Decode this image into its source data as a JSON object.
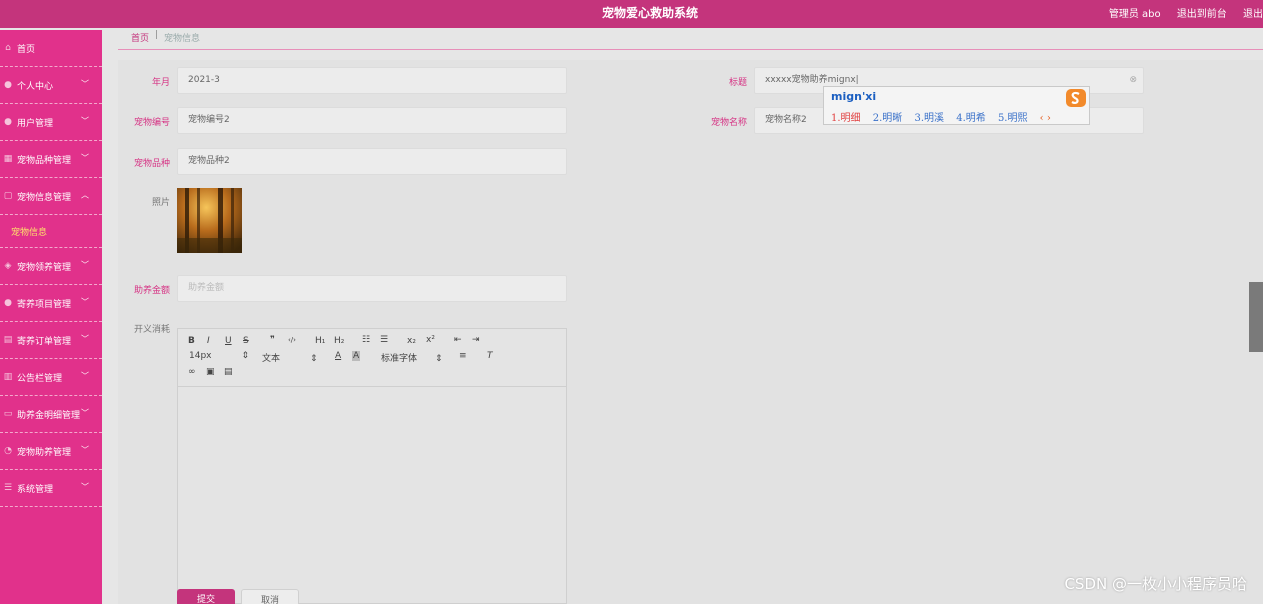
{
  "header": {
    "app_title": "宠物爱心救助系统",
    "admin_label": "管理员 abo",
    "front_link": "退出到前台",
    "logout_link": "退出"
  },
  "sidebar": {
    "items": [
      {
        "label": "首页",
        "icon": "home-icon"
      },
      {
        "label": "个人中心",
        "icon": "user-icon",
        "chevron": "﹀"
      },
      {
        "label": "用户管理",
        "icon": "users-icon",
        "chevron": "﹀"
      },
      {
        "label": "宠物品种管理",
        "icon": "grid-icon",
        "chevron": "﹀"
      },
      {
        "label": "宠物信息管理",
        "icon": "box-icon",
        "chevron": "︿"
      },
      {
        "label": "宠物领养管理",
        "icon": "handshake-icon",
        "chevron": "﹀"
      },
      {
        "label": "寄养项目管理",
        "icon": "person-icon",
        "chevron": "﹀"
      },
      {
        "label": "寄养订单管理",
        "icon": "order-icon",
        "chevron": "﹀"
      },
      {
        "label": "公告栏管理",
        "icon": "chart-icon",
        "chevron": "﹀"
      },
      {
        "label": "助养金明细管理",
        "icon": "list-icon",
        "chevron": "﹀"
      },
      {
        "label": "宠物助养管理",
        "icon": "clock-icon",
        "chevron": "﹀"
      },
      {
        "label": "系统管理",
        "icon": "menu-icon",
        "chevron": "﹀"
      }
    ],
    "sub_item": "宠物信息"
  },
  "breadcrumb": {
    "home": "首页",
    "separator": "|",
    "current": "宠物信息"
  },
  "form": {
    "year_month_label": "年月",
    "year_month_value": "2021-3",
    "title_label": "标题",
    "title_value": "xxxxx宠物助养mignx|",
    "pet_no_label": "宠物编号",
    "pet_no_value": "宠物编号2",
    "pet_name_label": "宠物名称",
    "pet_name_value": "宠物名称2",
    "pet_breed_label": "宠物品种",
    "pet_breed_value": "宠物品种2",
    "photo_label": "照片",
    "amount_label": "助养金额",
    "amount_placeholder": "助养金额",
    "details_label": "开义消耗",
    "submit_label": "提交",
    "cancel_label": "取消"
  },
  "editor": {
    "font_size": "14px",
    "text_style": "文本",
    "font_family": "标准字体",
    "buttons": [
      "B",
      "I",
      "U",
      "S",
      "❞",
      "‹/›",
      "H₁",
      "H₂"
    ]
  },
  "ime": {
    "pinyin": "mign'xi",
    "candidates": [
      "1.明细",
      "2.明晰",
      "3.明溪",
      "4.明希",
      "5.明熙"
    ],
    "nav": "‹ ›"
  },
  "watermark": "CSDN @一枚小小程序员哈",
  "colors": {
    "accent": "#e1318b",
    "header": "#c4347c",
    "label": "#d63384"
  }
}
